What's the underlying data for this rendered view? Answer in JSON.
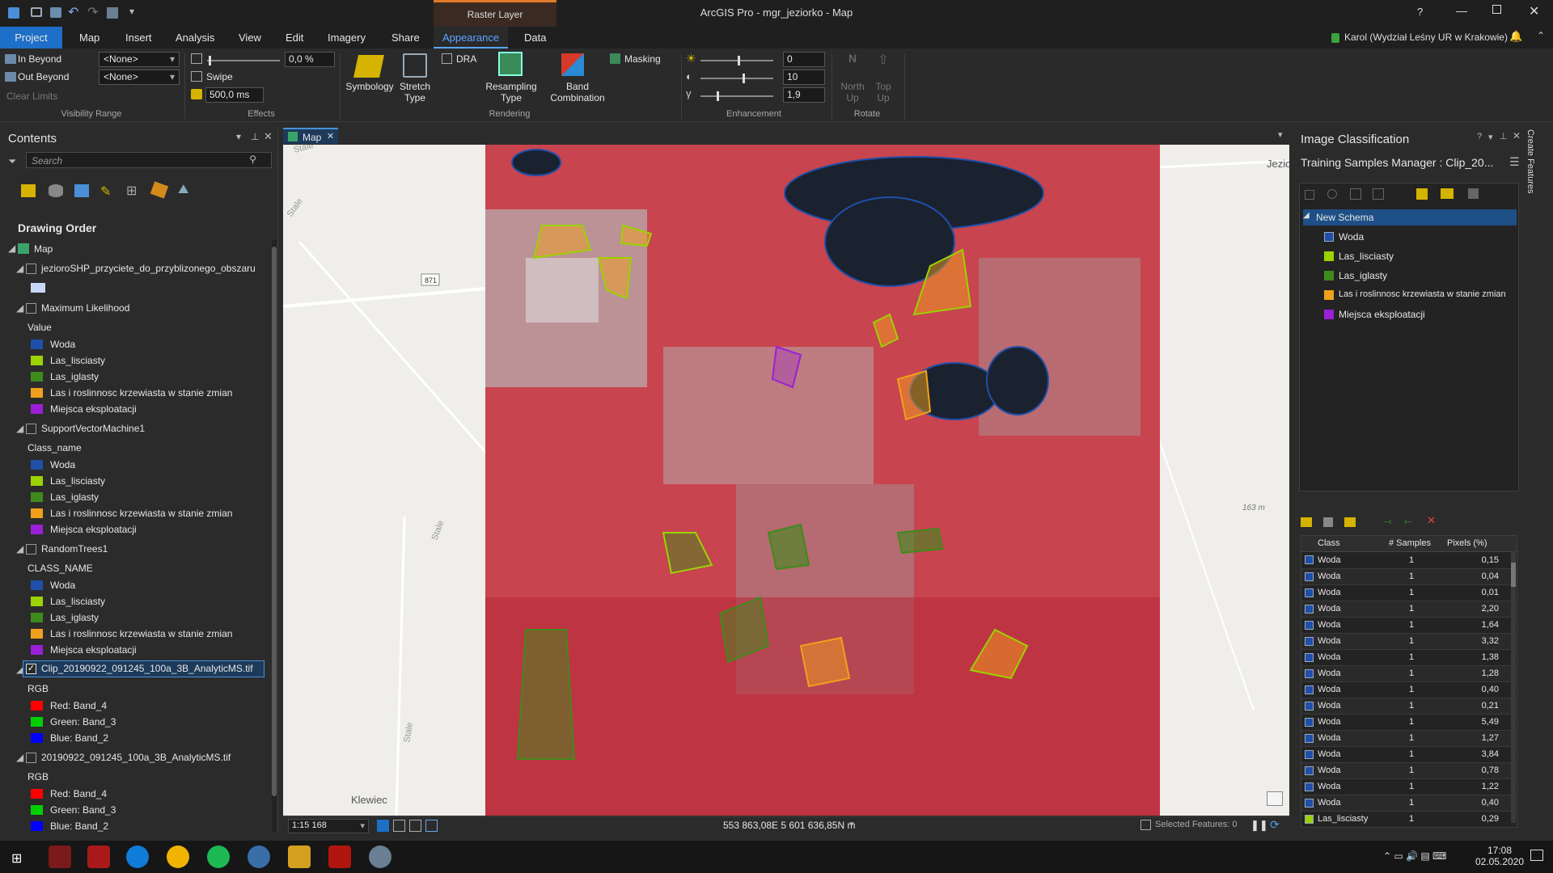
{
  "window": {
    "title": "ArcGIS Pro - mgr_jeziorko - Map",
    "context_tab": "Raster Layer",
    "help": "?"
  },
  "ribbon_tabs": [
    "Project",
    "Map",
    "Insert",
    "Analysis",
    "View",
    "Edit",
    "Imagery",
    "Share",
    "Appearance",
    "Data"
  ],
  "active_tab": "Appearance",
  "user": {
    "name": "Karol (Wydział Leśny UR w Krakowie)"
  },
  "ribbon": {
    "visibility": {
      "in_beyond_label": "In Beyond",
      "out_beyond_label": "Out Beyond",
      "in_value": "<None>",
      "out_value": "<None>",
      "clear_label": "Clear Limits",
      "group_label": "Visibility Range"
    },
    "effects": {
      "transparency": "0,0 %",
      "swipe_label": "Swipe",
      "flicker": "500,0 ms",
      "group_label": "Effects"
    },
    "rendering": {
      "symbology": "Symbology",
      "stretch": "Stretch",
      "stretch2": "Type",
      "dra": "DRA",
      "resampling": "Resampling",
      "resampling2": "Type",
      "band": "Band",
      "band2": "Combination",
      "masking": "Masking",
      "group_label": "Rendering"
    },
    "enhancement": {
      "brightness": "0",
      "contrast": "10",
      "gamma": "1,9",
      "group_label": "Enhancement"
    },
    "rotate": {
      "north": "North",
      "north2": "Up",
      "top": "Top",
      "top2": "Up",
      "n_letter": "N",
      "group_label": "Rotate"
    }
  },
  "contents": {
    "title": "Contents",
    "search_placeholder": "Search",
    "drawing_order": "Drawing Order",
    "map_label": "Map",
    "layers": {
      "shp": "jezioroSHP_przyciete_do_przyblizonego_obszaru",
      "ml": {
        "name": "Maximum Likelihood",
        "field": "Value"
      },
      "svm": {
        "name": "SupportVectorMachine1",
        "field": "Class_name"
      },
      "rt": {
        "name": "RandomTrees1",
        "field": "CLASS_NAME"
      },
      "clip": {
        "name": "Clip_20190922_091245_100a_3B_AnalyticMS.tif",
        "mode": "RGB",
        "red": "Red:  Band_4",
        "green": "Green: Band_3",
        "blue": "Blue:  Band_2"
      },
      "full": {
        "name": "20190922_091245_100a_3B_AnalyticMS.tif",
        "mode": "RGB",
        "red": "Red:  Band_4",
        "green": "Green: Band_3",
        "blue": "Blue:  Band_2"
      }
    },
    "classes": [
      {
        "name": "Woda",
        "color": "#1f4fa8"
      },
      {
        "name": "Las_lisciasty",
        "color": "#9bd200"
      },
      {
        "name": "Las_iglasty",
        "color": "#3f8a1c"
      },
      {
        "name": "Las i roslinnosc krzewiasta w stanie zmian",
        "color": "#f0a01c"
      },
      {
        "name": "Miejsca eksploatacji",
        "color": "#9a1fd6"
      }
    ]
  },
  "map": {
    "tab_label": "Map",
    "scale": "1:15 168",
    "coordinates": "553 863,08E 5 601 636,85N m",
    "selected_features": "Selected Features: 0",
    "labels": {
      "road_871": "871",
      "stale1": "Stale",
      "stale2": "Stale",
      "stale3": "Stale",
      "stale4": "Stale",
      "town": "Klewiec",
      "jezio": "Jezio",
      "elev": "163 m"
    }
  },
  "image_classification": {
    "title": "Image Classification",
    "manager_title": "Training Samples Manager : Clip_20...",
    "schema": "New Schema",
    "classes": [
      "Woda",
      "Las_lisciasty",
      "Las_iglasty",
      "Las i roslinnosc krzewiasta w stanie zmian",
      "Miejsca eksploatacji"
    ],
    "table_headers": [
      "Class",
      "# Samples",
      "Pixels (%)"
    ],
    "rows": [
      {
        "cls": "Woda",
        "n": "1",
        "px": "0,15"
      },
      {
        "cls": "Woda",
        "n": "1",
        "px": "0,04"
      },
      {
        "cls": "Woda",
        "n": "1",
        "px": "0,01"
      },
      {
        "cls": "Woda",
        "n": "1",
        "px": "2,20"
      },
      {
        "cls": "Woda",
        "n": "1",
        "px": "1,64"
      },
      {
        "cls": "Woda",
        "n": "1",
        "px": "3,32"
      },
      {
        "cls": "Woda",
        "n": "1",
        "px": "1,38"
      },
      {
        "cls": "Woda",
        "n": "1",
        "px": "1,28"
      },
      {
        "cls": "Woda",
        "n": "1",
        "px": "0,40"
      },
      {
        "cls": "Woda",
        "n": "1",
        "px": "0,21"
      },
      {
        "cls": "Woda",
        "n": "1",
        "px": "5,49"
      },
      {
        "cls": "Woda",
        "n": "1",
        "px": "1,27"
      },
      {
        "cls": "Woda",
        "n": "1",
        "px": "3,84"
      },
      {
        "cls": "Woda",
        "n": "1",
        "px": "0,78"
      },
      {
        "cls": "Woda",
        "n": "1",
        "px": "1,22"
      },
      {
        "cls": "Woda",
        "n": "1",
        "px": "0,40"
      },
      {
        "cls": "Las_lisciasty",
        "n": "1",
        "px": "0,29"
      }
    ]
  },
  "side_tab": "Create Features",
  "taskbar": {
    "time": "17:08",
    "date": "02.05.2020"
  }
}
